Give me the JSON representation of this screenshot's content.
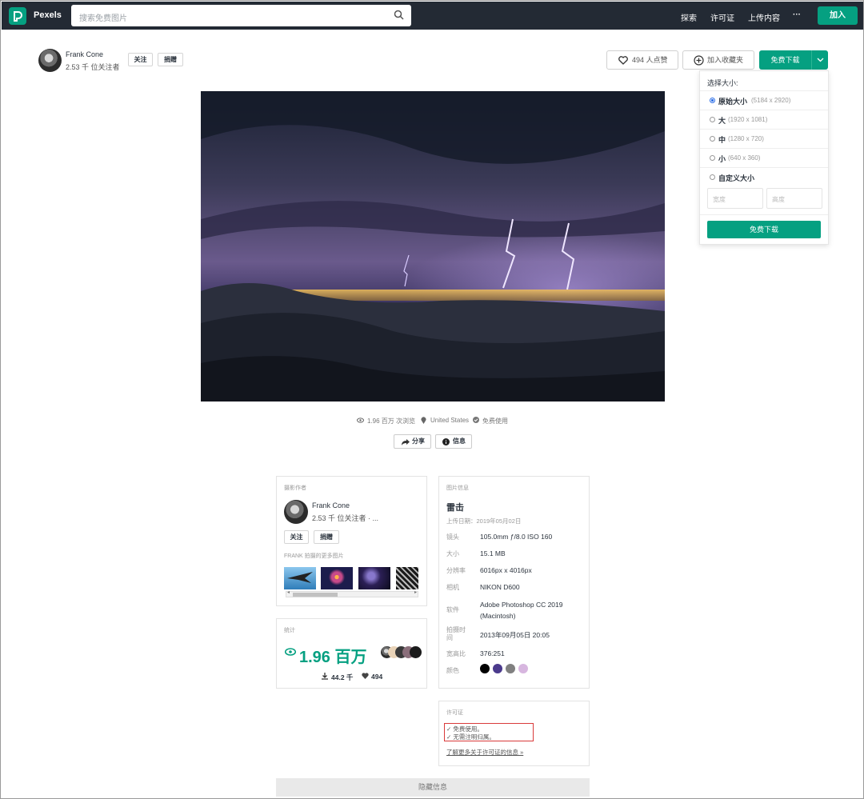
{
  "topbar": {
    "brand": "Pexels",
    "search_placeholder": "搜索免费图片",
    "nav": [
      "探索",
      "许可证",
      "上传内容"
    ],
    "more": "···",
    "join": "加入"
  },
  "author": {
    "name": "Frank Cone",
    "followers": "2.53 千 位关注者",
    "follow": "关注",
    "donate": "捐赠"
  },
  "actions": {
    "likes": "494 人点赞",
    "collect": "加入收藏夹",
    "download": "免费下载"
  },
  "size_menu": {
    "title": "选择大小:",
    "options": [
      {
        "label": "原始大小",
        "dim": "(5184 x 2920)",
        "selected": true
      },
      {
        "label": "大",
        "dim": "(1920 x 1081)",
        "selected": false
      },
      {
        "label": "中",
        "dim": "(1280 x 720)",
        "selected": false
      },
      {
        "label": "小",
        "dim": "(640 x 360)",
        "selected": false
      },
      {
        "label": "自定义大小",
        "dim": "",
        "selected": false
      }
    ],
    "width_placeholder": "宽度",
    "height_placeholder": "高度",
    "download": "免费下载"
  },
  "meta": {
    "views": "1.96 百万 次浏览",
    "location": "United States",
    "license": "免费使用"
  },
  "share": "分享",
  "info": "信息",
  "photographer_card": {
    "caption": "摄影作者",
    "name": "Frank Cone",
    "followers": "2.53 千 位关注者 · ...",
    "follow": "关注",
    "donate": "捐赠",
    "more": "FRANK 拍摄的更多图片"
  },
  "stats_card": {
    "caption": "统计",
    "views": "1.96 百万",
    "downloads": "44.2 千",
    "likes": "494"
  },
  "photo_info": {
    "caption": "图片信息",
    "title": "雷击",
    "uploaded": "上传日期：2019年05月02日",
    "rows": [
      {
        "k": "镜头",
        "v": "105.0mm ƒ/8.0 ISO 160"
      },
      {
        "k": "大小",
        "v": "15.1 MB"
      },
      {
        "k": "分辨率",
        "v": "6016px x 4016px"
      },
      {
        "k": "相机",
        "v": "NIKON D600"
      },
      {
        "k": "软件",
        "v": "Adobe Photoshop CC 2019 (Macintosh)"
      },
      {
        "k": "拍摄时间",
        "v": "2013年09月05日 20:05"
      },
      {
        "k": "宽高比",
        "v": "376:251"
      },
      {
        "k": "颜色",
        "v": ""
      }
    ],
    "colors": [
      "#000000",
      "#4b3a8c",
      "#808080",
      "#d7b6df"
    ]
  },
  "license_card": {
    "caption": "许可证",
    "line1": "✓ 免费使用。",
    "line2": "✓ 无需注明归属。",
    "link": "了解更多关于许可证的信息 »"
  },
  "hide_info": "隐藏信息"
}
